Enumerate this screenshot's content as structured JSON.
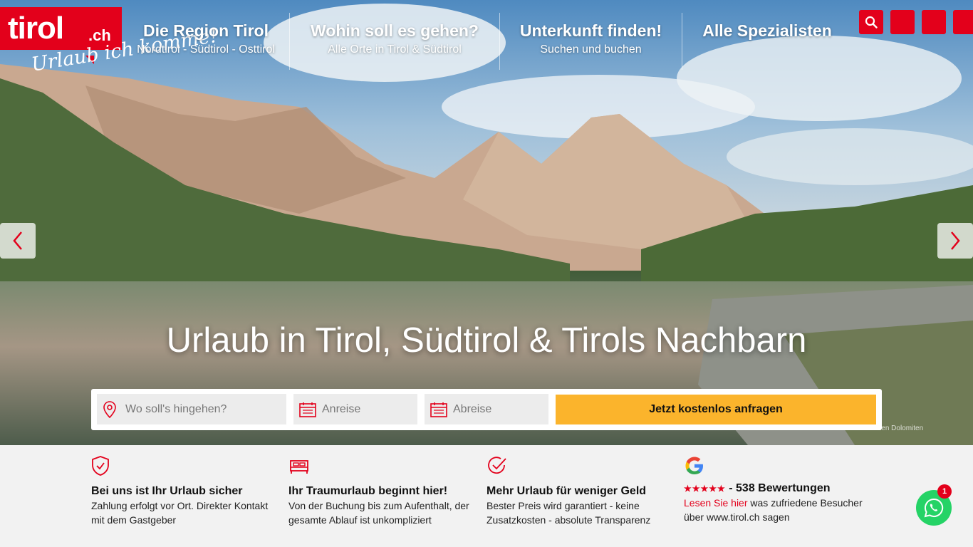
{
  "logo": {
    "text": "tirol",
    "tld": ".ch",
    "tagline": "Urlaub ich komme!"
  },
  "nav": [
    {
      "title": "Die Region Tirol",
      "subtitle": "Nordtirol - Südtirol - Osttirol"
    },
    {
      "title": "Wohin soll es gehen?",
      "subtitle": "Alle Orte in Tirol & Südtirol"
    },
    {
      "title": "Unterkunft finden!",
      "subtitle": "Suchen und buchen"
    },
    {
      "title": "Alle Spezialisten",
      "subtitle": ""
    }
  ],
  "top_buttons": {
    "search_icon": "search-icon"
  },
  "hero": {
    "headline": "Urlaub in Tirol, Südtirol & Tirols Nachbarn",
    "caption": "Grünsee in den Dolomiten"
  },
  "search": {
    "where_placeholder": "Wo soll's hingehen?",
    "arrival_placeholder": "Anreise",
    "departure_placeholder": "Abreise",
    "cta_label": "Jetzt kostenlos anfragen"
  },
  "features": [
    {
      "title": "Bei uns ist Ihr Urlaub sicher",
      "text": "Zahlung erfolgt vor Ort. Direkter Kontakt mit dem Gastgeber",
      "icon": "shield-check-icon"
    },
    {
      "title": "Ihr Traumurlaub beginnt hier!",
      "text": "Von der Buchung bis zum Aufenthalt, der gesamte Ablauf ist unkompliziert",
      "icon": "bed-icon"
    },
    {
      "title": "Mehr Urlaub für weniger Geld",
      "text": "Bester Preis wird garantiert - keine Zusatzkosten - absolute Transparenz",
      "icon": "circle-check-icon"
    }
  ],
  "reviews": {
    "stars": "★★★★★",
    "count_text": "- 538 Bewertungen",
    "link_text": "Lesen Sie hier",
    "rest_text": "was zufriedene Besucher über www.tirol.ch sagen",
    "icon": "google-icon"
  },
  "whatsapp": {
    "badge": "1"
  },
  "colors": {
    "brand_red": "#e3001b",
    "cta_yellow": "#fbb42c",
    "whatsapp_green": "#25d366"
  }
}
